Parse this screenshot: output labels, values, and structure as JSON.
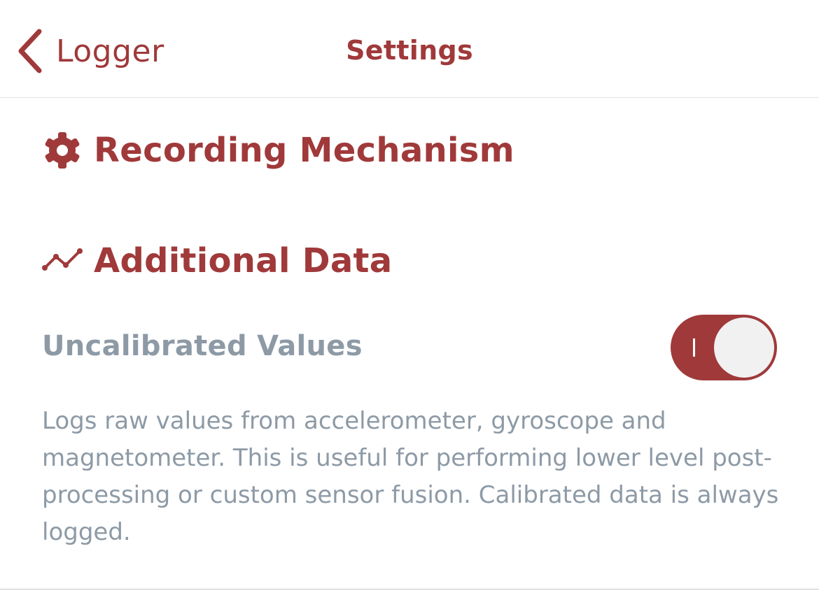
{
  "navbar": {
    "back_label": "Logger",
    "title": "Settings"
  },
  "sections": {
    "recording": {
      "title": "Recording Mechanism",
      "icon": "gear-icon"
    },
    "additional": {
      "title": "Additional Data",
      "icon": "line-chart-icon"
    }
  },
  "settings": {
    "uncalibrated": {
      "label": "Uncalibrated Values",
      "enabled": true,
      "description": "Logs raw values from accelerometer, gyroscope and magnetometer. This is useful for performing lower level post-processing or custom sensor fusion. Calibrated data is always logged."
    }
  },
  "colors": {
    "accent": "#a0393a",
    "muted_text": "#8d9aa6",
    "toggle_knob": "#f1f1f1"
  }
}
